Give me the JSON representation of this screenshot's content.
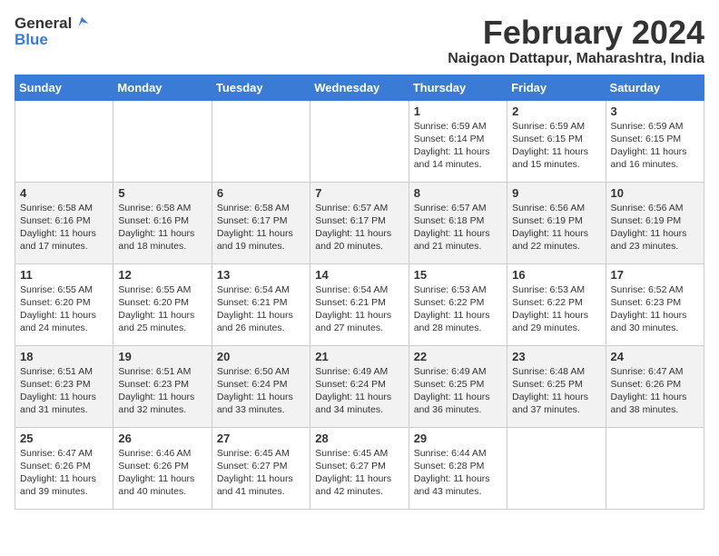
{
  "header": {
    "logo_general": "General",
    "logo_blue": "Blue",
    "title": "February 2024",
    "subtitle": "Naigaon Dattapur, Maharashtra, India"
  },
  "weekdays": [
    "Sunday",
    "Monday",
    "Tuesday",
    "Wednesday",
    "Thursday",
    "Friday",
    "Saturday"
  ],
  "weeks": [
    [
      {
        "day": "",
        "info": ""
      },
      {
        "day": "",
        "info": ""
      },
      {
        "day": "",
        "info": ""
      },
      {
        "day": "",
        "info": ""
      },
      {
        "day": "1",
        "info": "Sunrise: 6:59 AM\nSunset: 6:14 PM\nDaylight: 11 hours and 14 minutes."
      },
      {
        "day": "2",
        "info": "Sunrise: 6:59 AM\nSunset: 6:15 PM\nDaylight: 11 hours and 15 minutes."
      },
      {
        "day": "3",
        "info": "Sunrise: 6:59 AM\nSunset: 6:15 PM\nDaylight: 11 hours and 16 minutes."
      }
    ],
    [
      {
        "day": "4",
        "info": "Sunrise: 6:58 AM\nSunset: 6:16 PM\nDaylight: 11 hours and 17 minutes."
      },
      {
        "day": "5",
        "info": "Sunrise: 6:58 AM\nSunset: 6:16 PM\nDaylight: 11 hours and 18 minutes."
      },
      {
        "day": "6",
        "info": "Sunrise: 6:58 AM\nSunset: 6:17 PM\nDaylight: 11 hours and 19 minutes."
      },
      {
        "day": "7",
        "info": "Sunrise: 6:57 AM\nSunset: 6:17 PM\nDaylight: 11 hours and 20 minutes."
      },
      {
        "day": "8",
        "info": "Sunrise: 6:57 AM\nSunset: 6:18 PM\nDaylight: 11 hours and 21 minutes."
      },
      {
        "day": "9",
        "info": "Sunrise: 6:56 AM\nSunset: 6:19 PM\nDaylight: 11 hours and 22 minutes."
      },
      {
        "day": "10",
        "info": "Sunrise: 6:56 AM\nSunset: 6:19 PM\nDaylight: 11 hours and 23 minutes."
      }
    ],
    [
      {
        "day": "11",
        "info": "Sunrise: 6:55 AM\nSunset: 6:20 PM\nDaylight: 11 hours and 24 minutes."
      },
      {
        "day": "12",
        "info": "Sunrise: 6:55 AM\nSunset: 6:20 PM\nDaylight: 11 hours and 25 minutes."
      },
      {
        "day": "13",
        "info": "Sunrise: 6:54 AM\nSunset: 6:21 PM\nDaylight: 11 hours and 26 minutes."
      },
      {
        "day": "14",
        "info": "Sunrise: 6:54 AM\nSunset: 6:21 PM\nDaylight: 11 hours and 27 minutes."
      },
      {
        "day": "15",
        "info": "Sunrise: 6:53 AM\nSunset: 6:22 PM\nDaylight: 11 hours and 28 minutes."
      },
      {
        "day": "16",
        "info": "Sunrise: 6:53 AM\nSunset: 6:22 PM\nDaylight: 11 hours and 29 minutes."
      },
      {
        "day": "17",
        "info": "Sunrise: 6:52 AM\nSunset: 6:23 PM\nDaylight: 11 hours and 30 minutes."
      }
    ],
    [
      {
        "day": "18",
        "info": "Sunrise: 6:51 AM\nSunset: 6:23 PM\nDaylight: 11 hours and 31 minutes."
      },
      {
        "day": "19",
        "info": "Sunrise: 6:51 AM\nSunset: 6:23 PM\nDaylight: 11 hours and 32 minutes."
      },
      {
        "day": "20",
        "info": "Sunrise: 6:50 AM\nSunset: 6:24 PM\nDaylight: 11 hours and 33 minutes."
      },
      {
        "day": "21",
        "info": "Sunrise: 6:49 AM\nSunset: 6:24 PM\nDaylight: 11 hours and 34 minutes."
      },
      {
        "day": "22",
        "info": "Sunrise: 6:49 AM\nSunset: 6:25 PM\nDaylight: 11 hours and 36 minutes."
      },
      {
        "day": "23",
        "info": "Sunrise: 6:48 AM\nSunset: 6:25 PM\nDaylight: 11 hours and 37 minutes."
      },
      {
        "day": "24",
        "info": "Sunrise: 6:47 AM\nSunset: 6:26 PM\nDaylight: 11 hours and 38 minutes."
      }
    ],
    [
      {
        "day": "25",
        "info": "Sunrise: 6:47 AM\nSunset: 6:26 PM\nDaylight: 11 hours and 39 minutes."
      },
      {
        "day": "26",
        "info": "Sunrise: 6:46 AM\nSunset: 6:26 PM\nDaylight: 11 hours and 40 minutes."
      },
      {
        "day": "27",
        "info": "Sunrise: 6:45 AM\nSunset: 6:27 PM\nDaylight: 11 hours and 41 minutes."
      },
      {
        "day": "28",
        "info": "Sunrise: 6:45 AM\nSunset: 6:27 PM\nDaylight: 11 hours and 42 minutes."
      },
      {
        "day": "29",
        "info": "Sunrise: 6:44 AM\nSunset: 6:28 PM\nDaylight: 11 hours and 43 minutes."
      },
      {
        "day": "",
        "info": ""
      },
      {
        "day": "",
        "info": ""
      }
    ]
  ]
}
